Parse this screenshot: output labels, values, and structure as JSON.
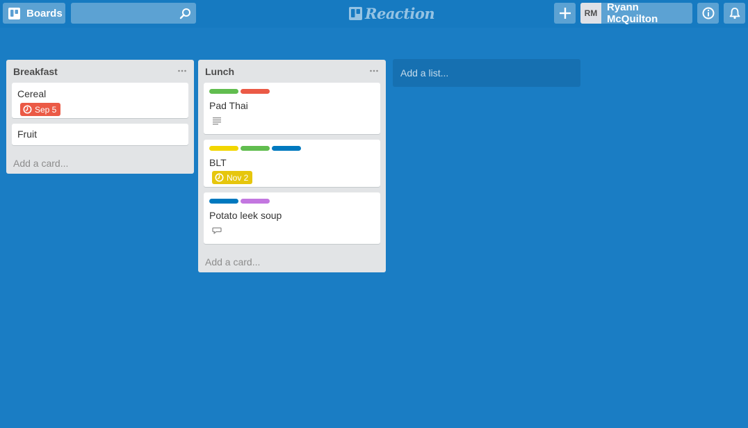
{
  "header": {
    "boards_label": "Boards",
    "search_value": "",
    "logo_text": "Reaction",
    "user_initials": "RM",
    "user_name": "Ryann McQuilton"
  },
  "colors": {
    "background": "#1a7dc4",
    "green": "#61bd4f",
    "red": "#eb5a46",
    "yellow": "#f2d600",
    "blue": "#0079bf",
    "purple": "#c377e0",
    "due_red": "#eb5a46",
    "due_yellow": "#e6c60d"
  },
  "lists": [
    {
      "title": "Breakfast",
      "cards": [
        {
          "title": "Cereal",
          "labels": [],
          "due": "Sep 5",
          "due_color": "red"
        },
        {
          "title": "Fruit",
          "labels": []
        }
      ],
      "add_card": "Add a card..."
    },
    {
      "title": "Lunch",
      "cards": [
        {
          "title": "Pad Thai",
          "labels": [
            "green",
            "red"
          ],
          "badge": "description-icon"
        },
        {
          "title": "BLT",
          "labels": [
            "yellow",
            "green",
            "blue"
          ],
          "due": "Nov 2",
          "due_color": "yellow"
        },
        {
          "title": "Potato leek soup",
          "labels": [
            "blue",
            "purple"
          ],
          "badge": "comment-icon"
        }
      ],
      "add_card": "Add a card..."
    }
  ],
  "add_list": "Add a list..."
}
